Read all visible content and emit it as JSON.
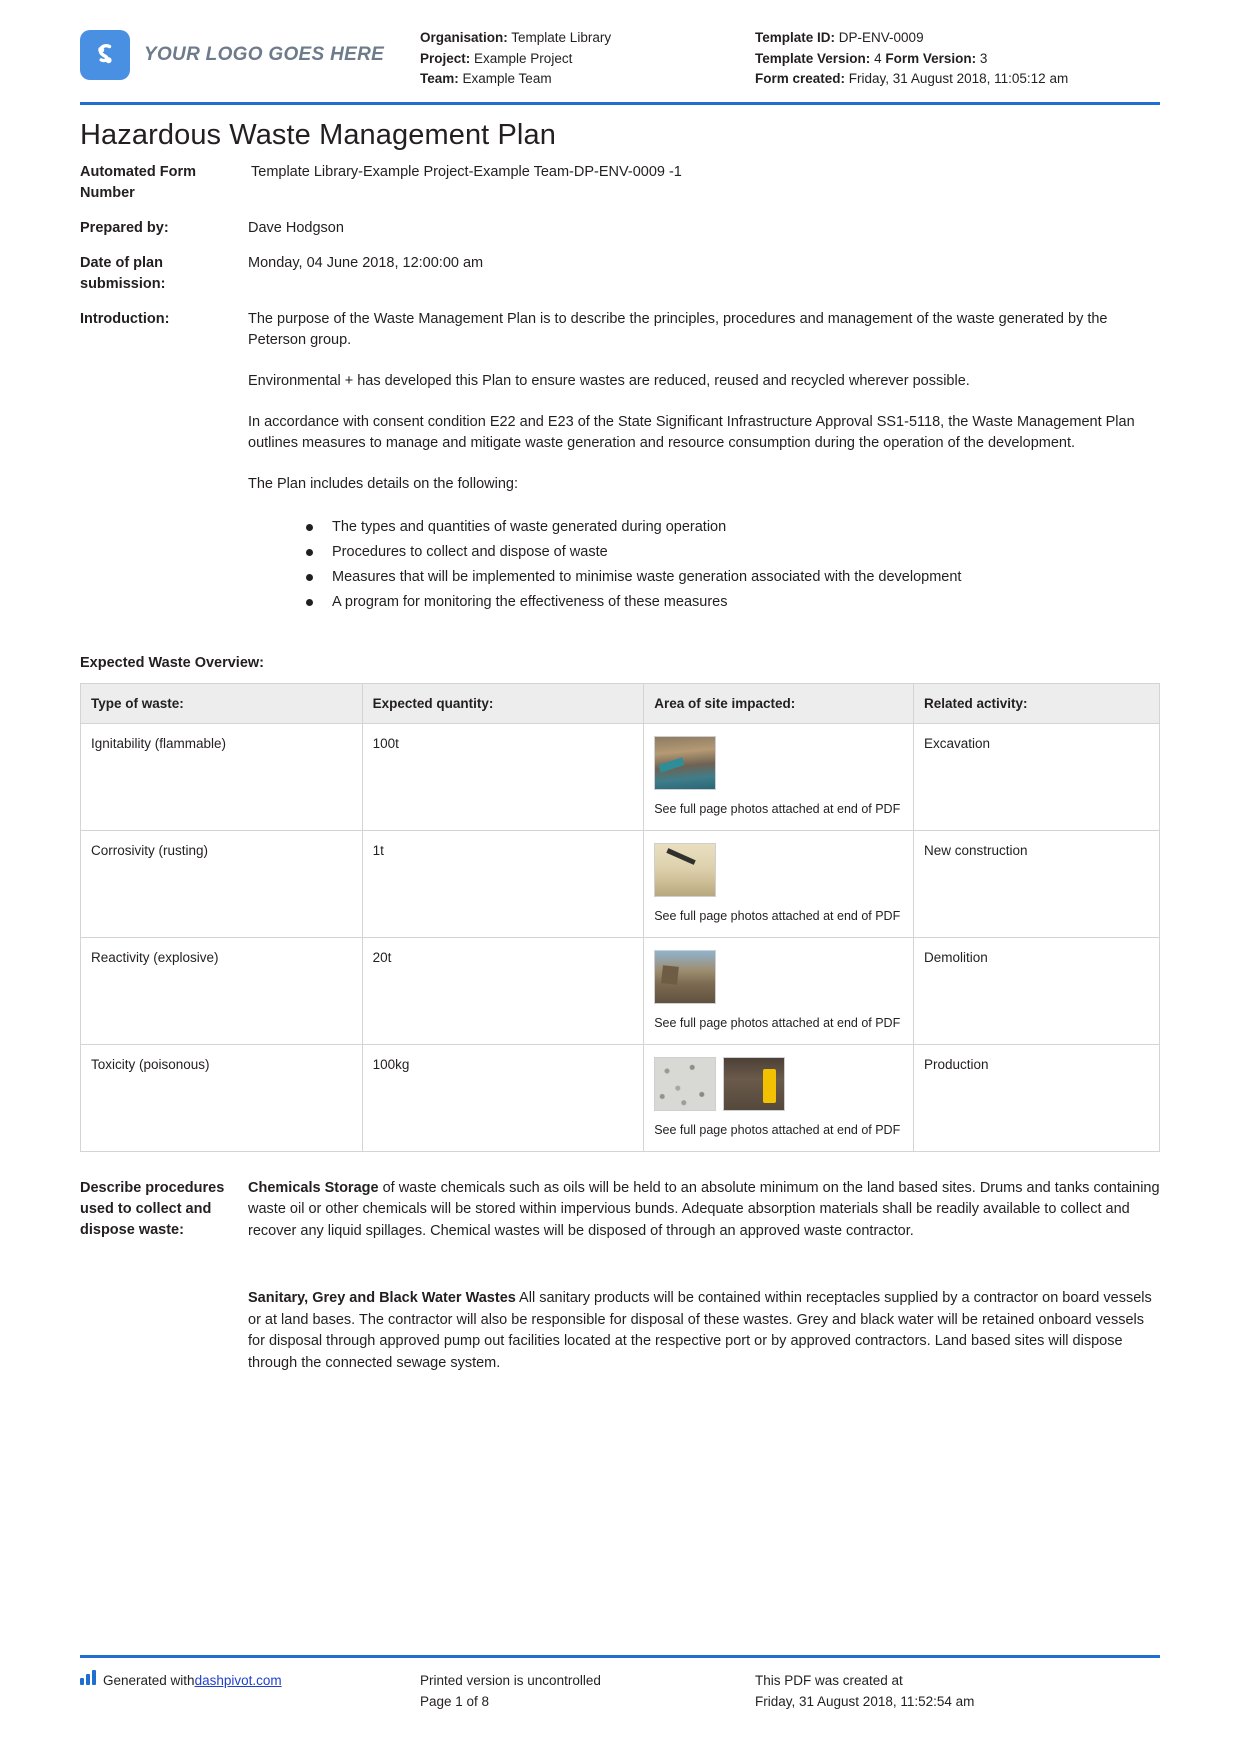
{
  "header": {
    "logo_text": "YOUR LOGO GOES HERE",
    "logo_icon": "dashpivot-logo-icon",
    "left_meta": [
      {
        "label": "Organisation:",
        "value": "Template Library"
      },
      {
        "label": "Project:",
        "value": "Example Project"
      },
      {
        "label": "Team:",
        "value": "Example Team"
      }
    ],
    "right_meta": [
      {
        "label": "Template ID:",
        "value": "DP-ENV-0009"
      },
      {
        "label": "Template Version:",
        "value": "4",
        "label2": "Form Version:",
        "value2": "3"
      },
      {
        "label": "Form created:",
        "value": "Friday, 31 August 2018, 11:05:12 am"
      }
    ]
  },
  "title": "Hazardous Waste Management Plan",
  "fields": {
    "automated_form_number_label": "Automated Form Number",
    "automated_form_number_value": "Template Library-Example Project-Example Team-DP-ENV-0009   -1",
    "prepared_by_label": "Prepared by:",
    "prepared_by_value": "Dave Hodgson",
    "date_of_plan_label": "Date of plan submission:",
    "date_of_plan_value": "Monday, 04 June 2018, 12:00:00 am",
    "introduction_label": "Introduction:",
    "introduction_p1": "The purpose of the Waste Management Plan is to describe the principles, procedures and management of the waste generated by the Peterson group.",
    "introduction_p2": "Environmental + has developed this Plan to ensure wastes are reduced, reused and recycled wherever possible.",
    "introduction_p3": "In accordance with consent condition E22 and E23 of the State Significant Infrastructure Approval SS1-5118, the Waste Management Plan outlines measures to manage and mitigate waste generation and resource consumption during the operation of the development.",
    "introduction_p4": "The Plan includes details on the following:",
    "introduction_bullets": [
      "The types and quantities of waste generated during operation",
      "Procedures to collect and dispose of waste",
      "Measures that will be implemented to minimise waste generation associated with the development",
      "A program for monitoring the effectiveness of these measures"
    ]
  },
  "table_section": {
    "label": "Expected Waste Overview:",
    "columns": [
      "Type of waste:",
      "Expected quantity:",
      "Area of site impacted:",
      "Related activity:"
    ],
    "photo_caption": "See full page photos attached at end of PDF",
    "rows": [
      {
        "type": "Ignitability (flammable)",
        "quantity": "100t",
        "photos": [
          "excavation-site-photo"
        ],
        "activity": "Excavation"
      },
      {
        "type": "Corrosivity (rusting)",
        "quantity": "1t",
        "photos": [
          "new-construction-photo"
        ],
        "activity": "New construction"
      },
      {
        "type": "Reactivity (explosive)",
        "quantity": "20t",
        "photos": [
          "demolition-site-photo"
        ],
        "activity": "Demolition"
      },
      {
        "type": "Toxicity (poisonous)",
        "quantity": "100kg",
        "photos": [
          "gravel-aggregate-photo",
          "chemical-drum-photo"
        ],
        "activity": "Production"
      }
    ]
  },
  "procedures": {
    "label": "Describe procedures used to collect and dispose waste:",
    "p1_bold": "Chemicals Storage",
    "p1_rest": " of waste chemicals such as oils will be held to an absolute minimum on the land based sites. Drums and tanks containing waste oil or other chemicals will be stored within impervious bunds. Adequate absorption materials shall be readily available to collect and recover any liquid spillages. Chemical wastes will be disposed of through an approved waste contractor.",
    "p2_bold": "Sanitary, Grey and Black Water Wastes",
    "p2_rest": " All sanitary products will be contained within receptacles supplied by a contractor on board vessels or at land bases. The contractor will also be responsible for disposal of these wastes. Grey and black water will be retained onboard vessels for disposal through approved pump out facilities located at the respective port or by approved contractors. Land based sites will dispose through the connected sewage system."
  },
  "footer": {
    "generated_prefix": "Generated with ",
    "generated_link": "dashpivot.com",
    "printed_line1": "Printed version is uncontrolled",
    "printed_line2": "Page 1 of 8",
    "created_line1": "This PDF was created at",
    "created_line2": "Friday, 31 August 2018, 11:52:54 am"
  },
  "colors": {
    "accent_blue": "#1f6fd0",
    "logo_blue": "#4a90e2",
    "table_header_grey": "#ededed"
  }
}
